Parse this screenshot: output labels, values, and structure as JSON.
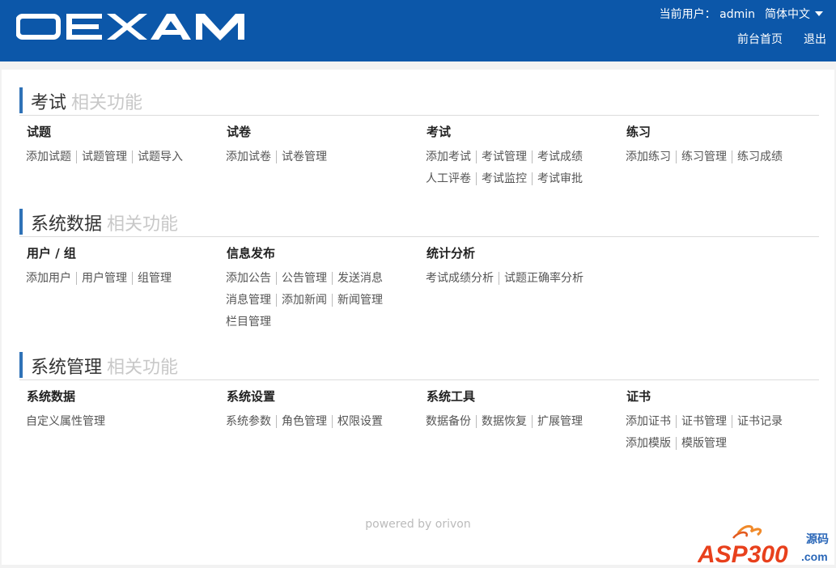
{
  "header": {
    "logo_text": "OEXAM",
    "current_user": "当前用户：  admin",
    "language": "简体中文",
    "home_link": "前台首页",
    "logout_link": "退出"
  },
  "sections": [
    {
      "title": "考试",
      "subtitle": "相关功能",
      "groups": [
        {
          "title": "试题",
          "links": [
            [
              "添加试题",
              "试题管理",
              "试题导入"
            ]
          ]
        },
        {
          "title": "试卷",
          "links": [
            [
              "添加试卷",
              "试卷管理"
            ]
          ]
        },
        {
          "title": "考试",
          "links": [
            [
              "添加考试",
              "考试管理",
              "考试成绩"
            ],
            [
              "人工评卷",
              "考试监控",
              "考试审批"
            ]
          ]
        },
        {
          "title": "练习",
          "links": [
            [
              "添加练习",
              "练习管理",
              "练习成绩"
            ]
          ]
        }
      ]
    },
    {
      "title": "系统数据",
      "subtitle": "相关功能",
      "groups": [
        {
          "title": "用户 / 组",
          "links": [
            [
              "添加用户",
              "用户管理",
              "组管理"
            ]
          ]
        },
        {
          "title": "信息发布",
          "links": [
            [
              "添加公告",
              "公告管理",
              "发送消息"
            ],
            [
              "消息管理",
              "添加新闻",
              "新闻管理"
            ],
            [
              "栏目管理"
            ]
          ]
        },
        {
          "title": "统计分析",
          "links": [
            [
              "考试成绩分析",
              "试题正确率分析"
            ]
          ]
        }
      ]
    },
    {
      "title": "系统管理",
      "subtitle": "相关功能",
      "groups": [
        {
          "title": "系统数据",
          "links": [
            [
              "自定义属性管理"
            ]
          ]
        },
        {
          "title": "系统设置",
          "links": [
            [
              "系统参数",
              "角色管理",
              "权限设置"
            ]
          ]
        },
        {
          "title": "系统工具",
          "links": [
            [
              "数据备份",
              "数据恢复",
              "扩展管理"
            ]
          ]
        },
        {
          "title": "证书",
          "links": [
            [
              "添加证书",
              "证书管理",
              "证书记录"
            ],
            [
              "添加模版",
              "模版管理"
            ]
          ]
        }
      ]
    }
  ],
  "footer": "powered by orivon",
  "watermark": {
    "brand": "ASP300",
    "suffix": "源码",
    "domain": ".com"
  },
  "colors": {
    "header_bg": "#0c57a9",
    "accent_bar": "#2f72b7",
    "muted_text": "#c8c8c8"
  }
}
